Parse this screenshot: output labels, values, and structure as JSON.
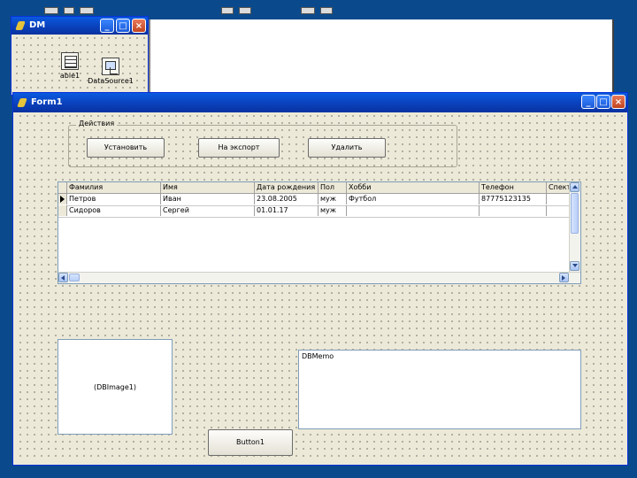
{
  "data_module": {
    "title": "DM",
    "components": [
      {
        "label": "able1",
        "icon": "table-icon"
      },
      {
        "label": "DataSource1",
        "icon": "datasource-icon"
      }
    ]
  },
  "form": {
    "title": "Form1",
    "groupbox": {
      "caption": "Действия",
      "buttons": [
        "Установить",
        "На экспорт",
        "Удалить"
      ]
    },
    "grid": {
      "columns": [
        "Фамилия",
        "Имя",
        "Дата рождения",
        "Пол",
        "Хобби",
        "Телефон",
        "Спектр"
      ],
      "rows": [
        [
          "Петров",
          "Иван",
          "23.08.2005",
          "муж",
          "Футбол",
          "87775123135",
          ""
        ],
        [
          "Сидоров",
          "Сергей",
          "01.01.17",
          "муж",
          "",
          "",
          ""
        ]
      ]
    },
    "dbimage_label": "(DBImage1)",
    "dbmemo_text": "DBMemo",
    "button1_label": "Button1"
  },
  "colors": {
    "desktop": "#0a4a8c",
    "titlebar": "#0a3fb8",
    "form_bg": "#ece9d8"
  }
}
